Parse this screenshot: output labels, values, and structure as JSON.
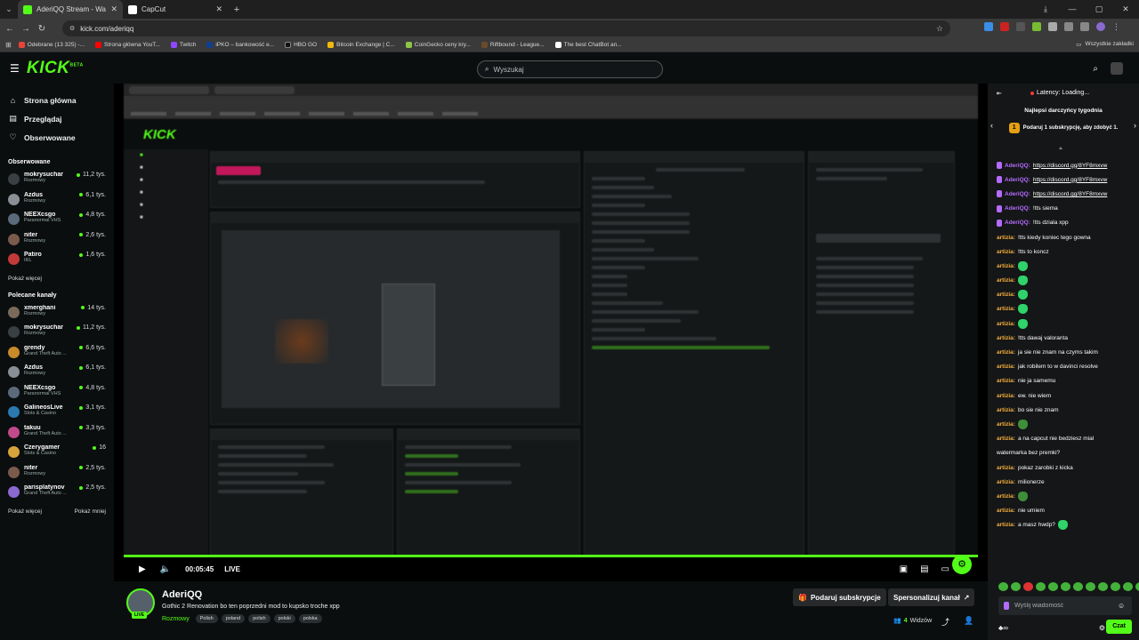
{
  "browser": {
    "tabs": [
      {
        "title": "AderiQQ Stream - Watch Live o",
        "active": true,
        "favicon_color": "#53fc18"
      },
      {
        "title": "CapCut",
        "active": false,
        "favicon_color": "#ffffff"
      }
    ],
    "url": "kick.com/aderiqq",
    "bookmarks": [
      {
        "label": "Odebrane (13 325) -...",
        "color": "#ea4335"
      },
      {
        "label": "Strona główna YouT...",
        "color": "#ff0000"
      },
      {
        "label": "Twitch",
        "color": "#9146ff"
      },
      {
        "label": "iPKO – bankowość e...",
        "color": "#0f3f8f"
      },
      {
        "label": "HBO GO",
        "color": "#111111"
      },
      {
        "label": "Bitcoin Exchange | C...",
        "color": "#f0b90b"
      },
      {
        "label": "CoinGecko ceny kry...",
        "color": "#8dc647"
      },
      {
        "label": "Riftbound - League...",
        "color": "#6a4a2a"
      },
      {
        "label": "The best ChatBot an...",
        "color": "#ffffff"
      }
    ],
    "all_bookmarks": "Wszystkie zakładki"
  },
  "header": {
    "logo": "KICK",
    "logo_sup": "BETA",
    "search_placeholder": "Wyszukaj"
  },
  "sidebar": {
    "nav": [
      {
        "label": "Strona główna",
        "icon": "home-icon",
        "glyph": "⌂"
      },
      {
        "label": "Przeglądaj",
        "icon": "browse-icon",
        "glyph": "▤"
      },
      {
        "label": "Obserwowane",
        "icon": "heart-icon",
        "glyph": "♡"
      }
    ],
    "followed_title": "Obserwowane",
    "followed": [
      {
        "name": "mokrysuchar",
        "category": "Rozmowy",
        "viewers": "11,2 tys.",
        "color": "#3a3f44"
      },
      {
        "name": "Azdus",
        "category": "Rozmowy",
        "viewers": "6,1 tys.",
        "color": "#8a8f95"
      },
      {
        "name": "NEEXcsgo",
        "category": "Paranormal VHS",
        "viewers": "4,8 tys.",
        "color": "#5b6a7a"
      },
      {
        "name": "niter",
        "category": "Rozmowy",
        "viewers": "2,6 tys.",
        "color": "#7a5a4a"
      },
      {
        "name": "Patiro",
        "category": "IRL",
        "viewers": "1,6 tys.",
        "color": "#c23a3a"
      }
    ],
    "show_more": "Pokaż więcej",
    "recommended_title": "Polecane kanały",
    "recommended": [
      {
        "name": "xmerghani",
        "category": "Rozmowy",
        "viewers": "14 tys.",
        "color": "#7a6a5a"
      },
      {
        "name": "mokrysuchar",
        "category": "Rozmowy",
        "viewers": "11,2 tys.",
        "color": "#3a3f44"
      },
      {
        "name": "grendy",
        "category": "Grand Theft Auto ...",
        "viewers": "6,6 tys.",
        "color": "#c98a2a"
      },
      {
        "name": "Azdus",
        "category": "Rozmowy",
        "viewers": "6,1 tys.",
        "color": "#8a8f95"
      },
      {
        "name": "NEEXcsgo",
        "category": "Paranormal VHS",
        "viewers": "4,8 tys.",
        "color": "#5b6a7a"
      },
      {
        "name": "GalineosLive",
        "category": "Slots & Casino",
        "viewers": "3,1 tys.",
        "color": "#2a7ab0"
      },
      {
        "name": "takuu",
        "category": "Grand Theft Auto ...",
        "viewers": "3,3 tys.",
        "color": "#c04a8a"
      },
      {
        "name": "Czerygamer",
        "category": "Slots & Casino",
        "viewers": "16",
        "color": "#d7a43a"
      },
      {
        "name": "niter",
        "category": "Rozmowy",
        "viewers": "2,5 tys.",
        "color": "#7a5a4a"
      },
      {
        "name": "parisplatynov",
        "category": "Grand Theft Auto ...",
        "viewers": "2,5 tys.",
        "color": "#8a6ad0"
      }
    ],
    "show_more2": "Pokaż więcej",
    "show_less": "Pokaż mniej"
  },
  "player": {
    "time": "00:05:45",
    "live": "LIVE"
  },
  "stream": {
    "channel": "AderiQQ",
    "live_badge": "LIVE",
    "title": "Gothic 2 Renovation bo ten poprzedni mod to kupsko troche xpp",
    "category": "Rozmowy",
    "tags": [
      "Polish",
      "poland",
      "polish",
      "polski",
      "polska"
    ],
    "subscribe_label": "Podaruj subskrypcje",
    "customize_label": "Spersonalizuj kanał",
    "viewers_count": "4",
    "viewers_label": "Widzów"
  },
  "chat": {
    "latency": "Latency: Loading...",
    "gifters_title": "Najlepsi darczyńcy tygodnia",
    "gift_rank": "1",
    "gift_text": "Podaruj 1 subskrypcję, aby zdobyć 1.",
    "messages": [
      {
        "user": "AderiQQ:",
        "text": "https://discord.gg/8YF8mxvw",
        "kind": "p",
        "link": true
      },
      {
        "user": "AderiQQ:",
        "text": "https://discord.gg/8YF8mxvw",
        "kind": "p",
        "link": true
      },
      {
        "user": "AderiQQ:",
        "text": "https://discord.gg/8YF8mxvw",
        "kind": "p",
        "link": true
      },
      {
        "user": "AderiQQ:",
        "text": "!tts siema",
        "kind": "p"
      },
      {
        "user": "AderiQQ:",
        "text": "!tts dziala xpp",
        "kind": "p"
      },
      {
        "user": "artizia:",
        "text": "!tts kiedy koniec tego gowna",
        "kind": "o"
      },
      {
        "user": "artizia:",
        "text": "!tts to koncz",
        "kind": "o"
      },
      {
        "user": "artizia:",
        "text": "",
        "kind": "o",
        "emote": "w"
      },
      {
        "user": "artizia:",
        "text": "",
        "kind": "o",
        "emote": "w"
      },
      {
        "user": "artizia:",
        "text": "",
        "kind": "o",
        "emote": "w"
      },
      {
        "user": "artizia:",
        "text": "",
        "kind": "o",
        "emote": "w"
      },
      {
        "user": "artizia:",
        "text": "",
        "kind": "o",
        "emote": "w"
      },
      {
        "user": "artizia:",
        "text": "!tts dawaj valoranta",
        "kind": "o"
      },
      {
        "user": "artizia:",
        "text": "ja sie nie znam na czyms takim",
        "kind": "o"
      },
      {
        "user": "artizia:",
        "text": "jak robilem to w davinci resolve",
        "kind": "o"
      },
      {
        "user": "artizia:",
        "text": "nie ja samemu",
        "kind": "o"
      },
      {
        "user": "artizia:",
        "text": "ew. nie wiem",
        "kind": "o"
      },
      {
        "user": "artizia:",
        "text": "bo sie nie znam",
        "kind": "o"
      },
      {
        "user": "artizia:",
        "text": "",
        "kind": "o",
        "emote": "g"
      },
      {
        "user": "artizia:",
        "text": "a na capcut nie bedziesz mial",
        "kind": "o"
      },
      {
        "user": "",
        "text": "watermarka bez premki?",
        "kind": "cont"
      },
      {
        "user": "artizia:",
        "text": "pokaz zarobki z kicka",
        "kind": "o"
      },
      {
        "user": "artizia:",
        "text": "milionerze",
        "kind": "o"
      },
      {
        "user": "artizia:",
        "text": "",
        "kind": "o",
        "emote": "g"
      },
      {
        "user": "artizia:",
        "text": "nie umiem",
        "kind": "o"
      },
      {
        "user": "artizia:",
        "text": "a masz hwdp?",
        "kind": "o",
        "emote_after": "gw"
      }
    ],
    "input_placeholder": "Wyślij wiadomość",
    "send_label": "Czat"
  }
}
